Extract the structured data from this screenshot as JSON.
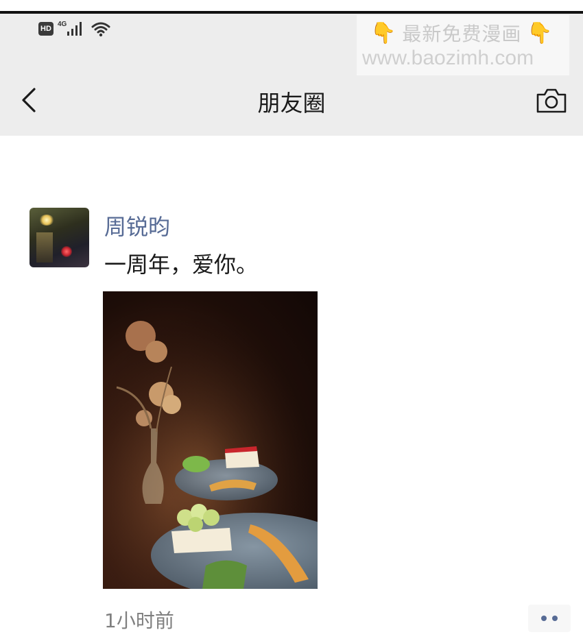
{
  "status_bar": {
    "hd_label": "HD",
    "network_label": "4G"
  },
  "watermark": {
    "title": "最新免费漫画",
    "url": "www.baozimh.com"
  },
  "header": {
    "title": "朋友圈",
    "back_icon": "chevron-left-icon",
    "camera_icon": "camera-icon",
    "background": "#ededed"
  },
  "post": {
    "author": "周锐昀",
    "text": "一周年，爱你。",
    "time": "1小时前",
    "author_color": "#576b95"
  }
}
